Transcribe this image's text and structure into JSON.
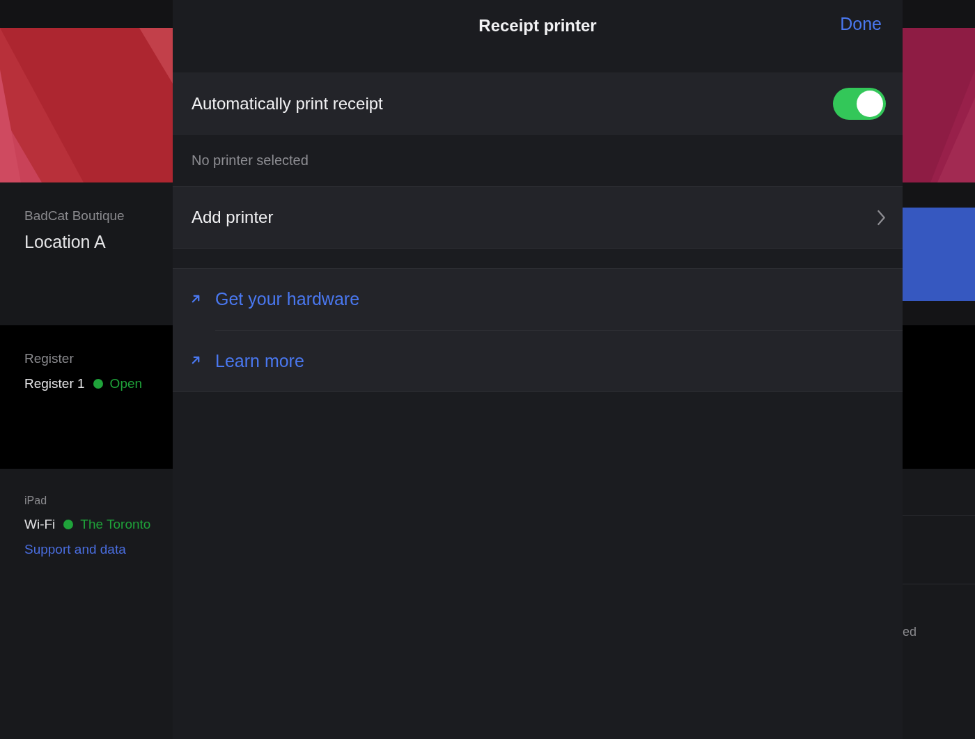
{
  "background_left": {
    "location": {
      "label": "BadCat Boutique",
      "value": "Location A"
    },
    "register": {
      "label": "Register",
      "name": "Register 1",
      "status": {
        "text": "Open",
        "color": "#1fa33a"
      }
    },
    "device": {
      "label": "iPad",
      "wifi": {
        "label": "Wi-Fi",
        "network": "The Toronto",
        "color": "#1fa33a"
      },
      "support_link": "Support and data"
    }
  },
  "background_right": {
    "fragment": "ed"
  },
  "sheet": {
    "title": "Receipt printer",
    "done": "Done",
    "toggle": {
      "label": "Automatically print receipt",
      "on": true
    },
    "section_header": "No printer selected",
    "add_printer": "Add printer",
    "links": [
      {
        "label": "Get your hardware"
      },
      {
        "label": "Learn more"
      }
    ]
  }
}
